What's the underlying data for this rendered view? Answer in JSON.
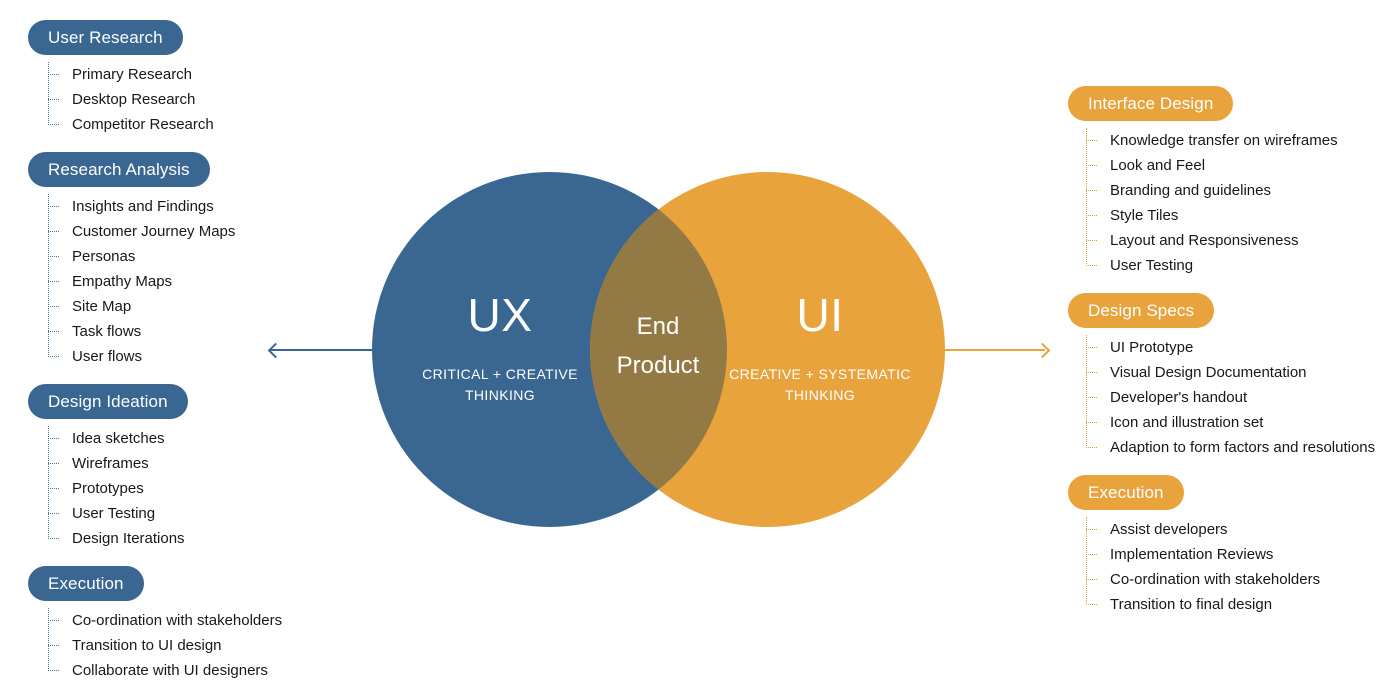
{
  "colors": {
    "blue": "#3a6791",
    "orange": "#e8a33d",
    "overlap": "#937a45",
    "text": "#16181c"
  },
  "venn": {
    "left": {
      "title": "UX",
      "subtitle_line1": "CRITICAL + CREATIVE",
      "subtitle_line2": "THINKING"
    },
    "center": {
      "title_line1": "End",
      "title_line2": "Product"
    },
    "right": {
      "title": "UI",
      "subtitle_line1": "CREATIVE + SYSTEMATIC",
      "subtitle_line2": "THINKING"
    }
  },
  "left_groups": [
    {
      "heading": "User Research",
      "items": [
        "Primary Research",
        "Desktop Research",
        "Competitor Research"
      ]
    },
    {
      "heading": "Research Analysis",
      "items": [
        "Insights and Findings",
        "Customer Journey Maps",
        "Personas",
        "Empathy Maps",
        "Site Map",
        "Task flows",
        "User flows"
      ]
    },
    {
      "heading": "Design Ideation",
      "items": [
        "Idea sketches",
        "Wireframes",
        "Prototypes",
        "User Testing",
        "Design Iterations"
      ]
    },
    {
      "heading": "Execution",
      "items": [
        "Co-ordination with stakeholders",
        "Transition to UI design",
        "Collaborate with UI designers"
      ]
    }
  ],
  "right_groups": [
    {
      "heading": "Interface Design",
      "items": [
        "Knowledge transfer on wireframes",
        "Look and Feel",
        "Branding and guidelines",
        "Style Tiles",
        "Layout and Responsiveness",
        "User Testing"
      ]
    },
    {
      "heading": "Design Specs",
      "items": [
        "UI Prototype",
        "Visual Design Documentation",
        "Developer's handout",
        "Icon and illustration set",
        "Adaption to form factors and resolutions"
      ]
    },
    {
      "heading": "Execution",
      "items": [
        "Assist developers",
        "Implementation Reviews",
        "Co-ordination with stakeholders",
        "Transition to final design"
      ]
    }
  ]
}
